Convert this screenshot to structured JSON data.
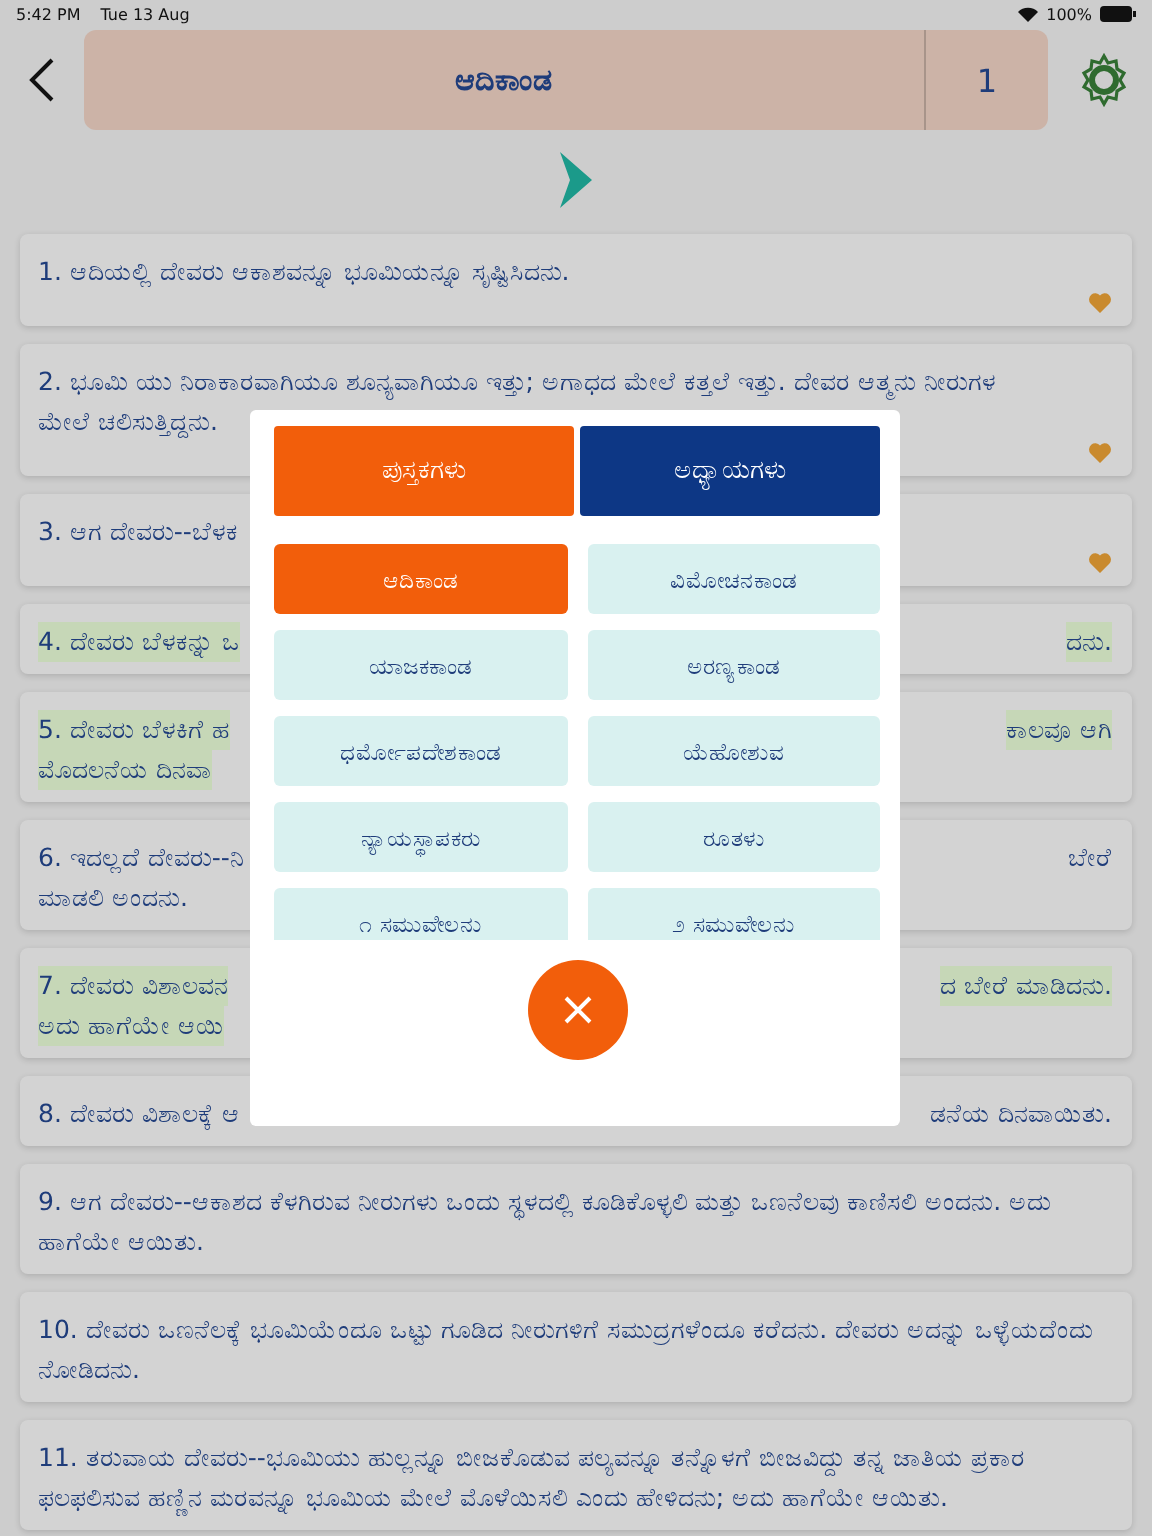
{
  "status_bar": {
    "time": "5:42 PM",
    "date": "Tue 13 Aug",
    "battery": "100%"
  },
  "header": {
    "book": "ಆದಿಕಾಂಡ",
    "chapter": "1"
  },
  "verses": [
    {
      "highlighted": false,
      "favorite": true,
      "lines": [
        {
          "left": "1. ಆದಿಯಲ್ಲಿ ದೇವರು ಆಕಾಶವನ್ನೂ ಭೂಮಿಯನ್ನೂ ಸೃಷ್ಟಿಸಿದನು."
        }
      ]
    },
    {
      "highlighted": false,
      "favorite": true,
      "lines": [
        {
          "left": "2. ಭೂಮಿ ಯು ನಿರಾಕಾರವಾಗಿಯೂ ಶೂನ್ಯವಾಗಿಯೂ ಇತ್ತು; ಅಗಾಧದ ಮೇಲೆ ಕತ್ತಲೆ ಇತ್ತು. ದೇವರ ಆತ್ಮನು ನೀರುಗಳ"
        },
        {
          "left": "ಮೇಲೆ ಚಲಿಸುತ್ತಿದ್ದನು."
        }
      ]
    },
    {
      "highlighted": false,
      "favorite": true,
      "lines": [
        {
          "left": "3. ಆಗ ದೇವರು--ಬೆಳಕ"
        }
      ]
    },
    {
      "highlighted": true,
      "favorite": false,
      "lines": [
        {
          "left": "4. ದೇವರು ಬೆಳಕನ್ನು ಒ",
          "right": "ದನು."
        }
      ]
    },
    {
      "highlighted": true,
      "favorite": false,
      "lines": [
        {
          "left": "5. ದೇವರು ಬೆಳಕಿಗೆ ಹ",
          "right": "ಕಾಲವೂ ಆಗಿ"
        },
        {
          "left": "ಮೊದಲನೆಯ ದಿನವಾ"
        }
      ]
    },
    {
      "highlighted": false,
      "favorite": false,
      "lines": [
        {
          "left": "6. ಇದಲ್ಲದೆ ದೇವರು--ನಿ",
          "right": "ಬೇರೆ"
        },
        {
          "left": "ಮಾಡಲಿ ಅಂದನು."
        }
      ]
    },
    {
      "highlighted": true,
      "favorite": false,
      "lines": [
        {
          "left": "7. ದೇವರು ವಿಶಾಲವನ",
          "right": "ದ ಬೇರೆ ಮಾಡಿದನು."
        },
        {
          "left": "ಅದು ಹಾಗೆಯೇ ಆಯಿ"
        }
      ]
    },
    {
      "highlighted": false,
      "favorite": false,
      "lines": [
        {
          "left": "8. ದೇವರು ವಿಶಾಲಕ್ಕೆ ಆ",
          "right": "ಡನೆಯ ದಿನವಾಯಿತು."
        }
      ]
    },
    {
      "highlighted": false,
      "favorite": false,
      "lines": [
        {
          "left": "9. ಆಗ ದೇವರು--ಆಕಾಶದ ಕೆಳಗಿರುವ ನೀರುಗಳು ಒಂದು ಸ್ಥಳದಲ್ಲಿ ಕೂಡಿಕೊಳ್ಳಲಿ ಮತ್ತು ಒಣನೆಲವು ಕಾಣಿಸಲಿ ಅಂದನು. ಅದು ಹಾಗೆಯೇ ಆಯಿತು."
        }
      ]
    },
    {
      "highlighted": false,
      "favorite": false,
      "lines": [
        {
          "left": "10. ದೇವರು ಒಣನೆಲಕ್ಕೆ ಭೂಮಿಯೆಂದೂ ಒಟ್ಟು ಗೂಡಿದ ನೀರುಗಳಿಗೆ ಸಮುದ್ರಗಳೆಂದೂ ಕರೆದನು. ದೇವರು ಅದನ್ನು ಒಳ್ಳೆಯದೆಂದು ನೋಡಿದನು."
        }
      ]
    },
    {
      "highlighted": false,
      "favorite": false,
      "lines": [
        {
          "left": "11. ತರುವಾಯ ದೇವರು--ಭೂಮಿಯು ಹುಲ್ಲನ್ನೂ ಬೀಜಕೊಡುವ ಪಲ್ಯವನ್ನೂ ತನ್ನೊಳಗೆ ಬೀಜವಿದ್ದು ತನ್ನ ಜಾತಿಯ ಪ್ರಕಾರ ಫಲಫಲಿಸುವ ಹಣ್ಣಿನ ಮರವನ್ನೂ ಭೂಮಿಯ ಮೇಲೆ ಮೊಳೆಯಿಸಲಿ ಎಂದು ಹೇಳಿದನು; ಅದು ಹಾಗೆಯೇ ಆಯಿತು."
        }
      ]
    }
  ],
  "picker": {
    "tabs": [
      {
        "label": "ಪುಸ್ತಕಗಳು",
        "selected": true
      },
      {
        "label": "ಅಧ್ಯಾಯಗಳು",
        "selected": false
      }
    ],
    "books": [
      {
        "label": "ಆದಿಕಾಂಡ",
        "selected": true
      },
      {
        "label": "ವಿಮೋಚನಕಾಂಡ",
        "selected": false
      },
      {
        "label": "ಯಾಜಕಕಾಂಡ",
        "selected": false
      },
      {
        "label": "ಅರಣ್ಯಕಾಂಡ",
        "selected": false
      },
      {
        "label": "ಧರ್ಮೋಪದೇಶಕಾಂಡ",
        "selected": false
      },
      {
        "label": "ಯೆಹೋಶುವ",
        "selected": false
      },
      {
        "label": "ನ್ಯಾಯಸ್ಥಾಪಕರು",
        "selected": false
      },
      {
        "label": "ರೂತಳು",
        "selected": false
      },
      {
        "label": "೧ ಸಮುವೇಲನು",
        "selected": false
      },
      {
        "label": "೨ ಸಮುವೇಲನು",
        "selected": false
      }
    ]
  }
}
